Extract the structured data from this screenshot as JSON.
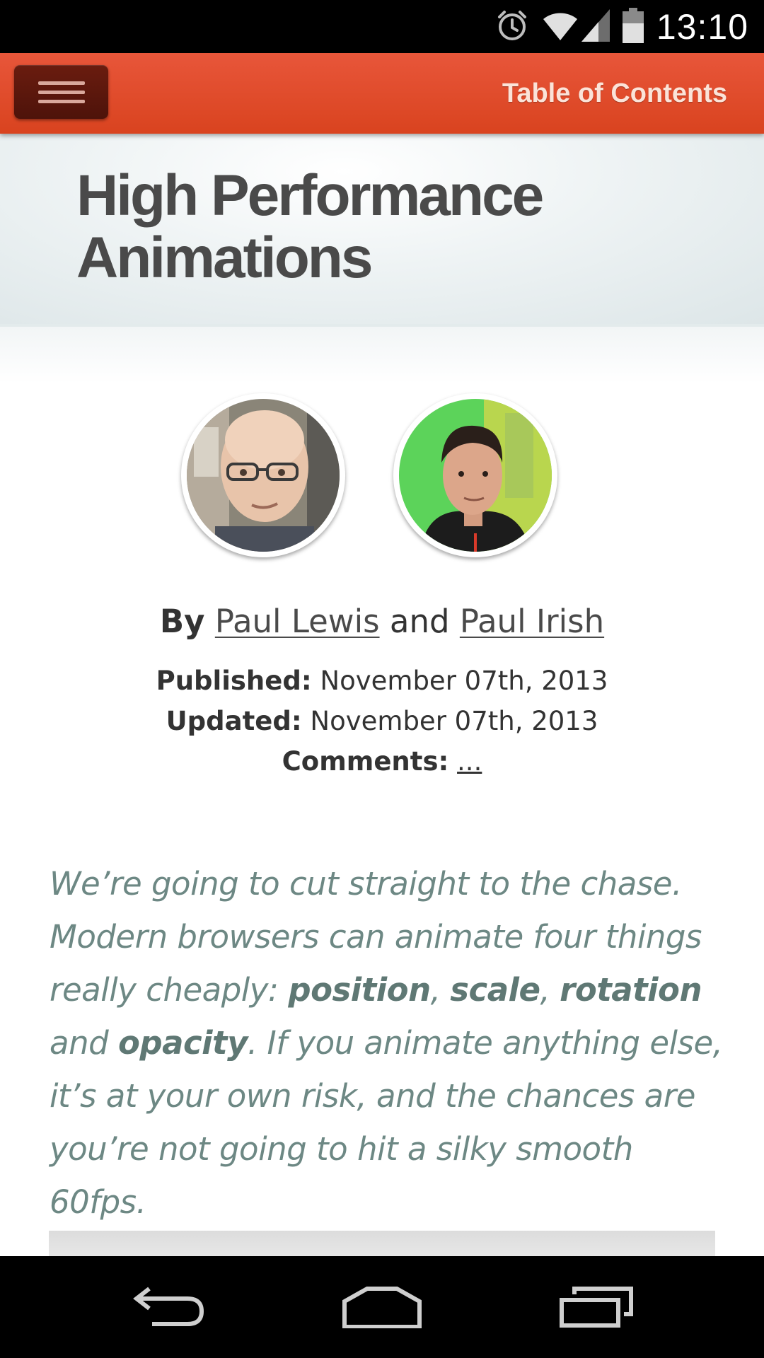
{
  "status_bar": {
    "time": "13:10",
    "icons": [
      "alarm-icon",
      "wifi-icon",
      "signal-icon",
      "battery-icon"
    ]
  },
  "app_bar": {
    "menu_icon": "hamburger-menu-icon",
    "toc_label": "Table of Contents",
    "color": "#e04e2c"
  },
  "article": {
    "title_line1": "High Performance",
    "title_line2": "Animations",
    "byline": {
      "prefix": "By",
      "author1": "Paul Lewis",
      "conjunction": "and",
      "author2": "Paul Irish"
    },
    "published_label": "Published:",
    "published_value": "November 07th, 2013",
    "updated_label": "Updated:",
    "updated_value": "November 07th, 2013",
    "comments_label": "Comments:",
    "comments_value": "...",
    "intro": {
      "p1": "We’re going to cut straight to the chase. Modern browsers can animate four things really cheaply: ",
      "k1": "position",
      "s1": ", ",
      "k2": "scale",
      "s2": ", ",
      "k3": "rotation",
      "s3": " and ",
      "k4": "opacity",
      "p2": ". If you animate anything else, it’s at your own risk, and the chances are you’re not going to hit a silky smooth 60fps."
    }
  },
  "nav_bar": {
    "icons": [
      "back-icon",
      "home-icon",
      "recent-apps-icon"
    ]
  }
}
